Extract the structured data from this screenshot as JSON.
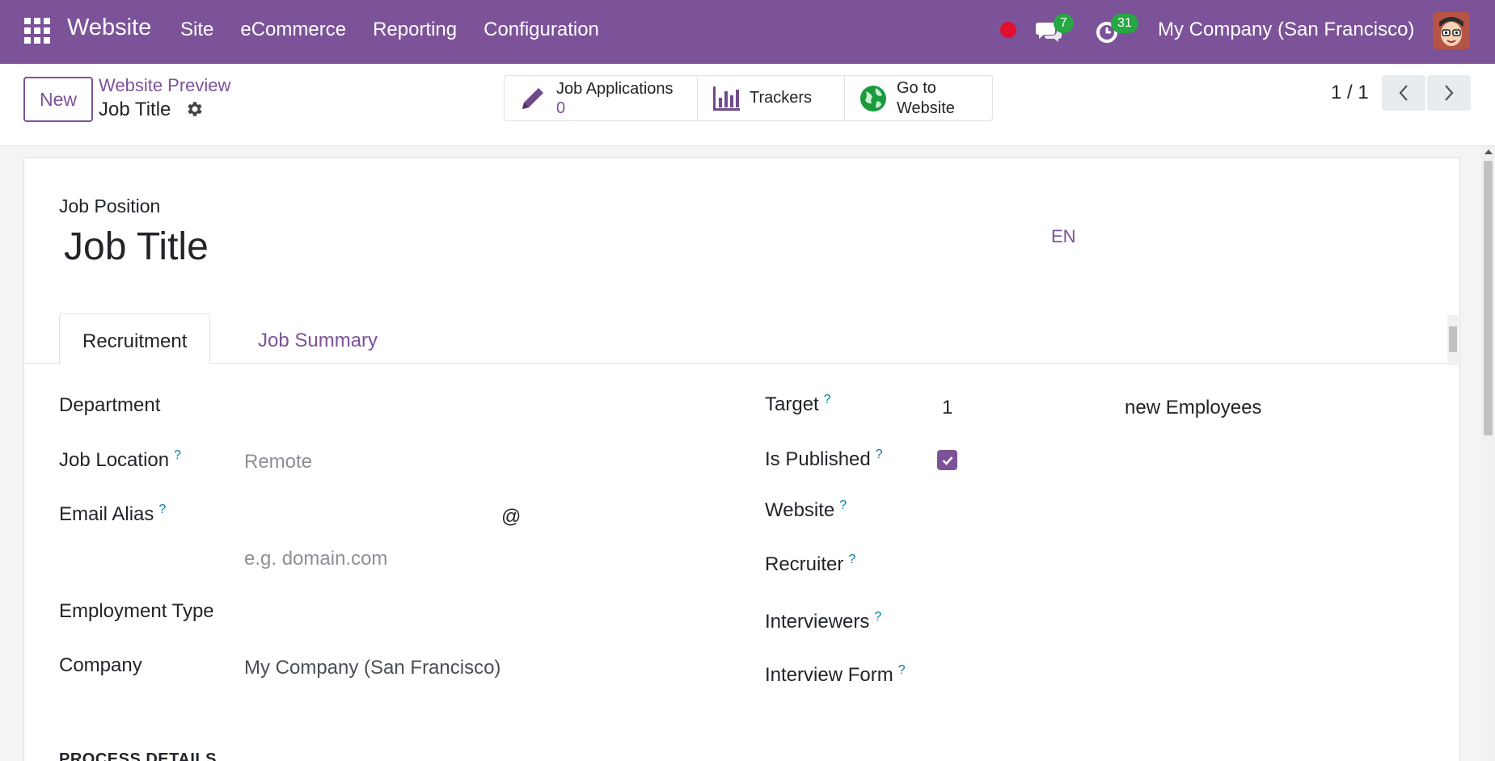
{
  "navbar": {
    "app_name": "Website",
    "menu": [
      "Site",
      "eCommerce",
      "Reporting",
      "Configuration"
    ],
    "messages_count": "7",
    "activities_count": "31",
    "company": "My Company (San Francisco)"
  },
  "control_panel": {
    "new_label": "New",
    "breadcrumb_parent": "Website Preview",
    "breadcrumb_current": "Job Title",
    "smart_buttons": {
      "job_applications_label": "Job Applications",
      "job_applications_count": "0",
      "trackers_label": "Trackers",
      "go_to_website_line1": "Go to",
      "go_to_website_line2": "Website"
    },
    "pager": "1 / 1"
  },
  "form": {
    "header_label": "Job Position",
    "title": "Job Title",
    "lang": "EN",
    "tabs": [
      "Recruitment",
      "Job Summary"
    ],
    "left": {
      "department_label": "Department",
      "job_location_label": "Job Location",
      "job_location_placeholder": "Remote",
      "email_alias_label": "Email Alias",
      "email_at": "@",
      "email_domain_placeholder": "e.g. domain.com",
      "employment_type_label": "Employment Type",
      "company_label": "Company",
      "company_value": "My Company (San Francisco)"
    },
    "right": {
      "target_label": "Target",
      "target_value": "1",
      "target_suffix": "new Employees",
      "is_published_label": "Is Published",
      "website_label": "Website",
      "recruiter_label": "Recruiter",
      "interviewers_label": "Interviewers",
      "interview_form_label": "Interview Form"
    },
    "help_mark": "?",
    "section_title": "PROCESS DETAILS"
  },
  "colors": {
    "brand": "#7c5299",
    "badge": "#28a745",
    "record_dot": "#e0102d",
    "help": "#0180a5"
  }
}
